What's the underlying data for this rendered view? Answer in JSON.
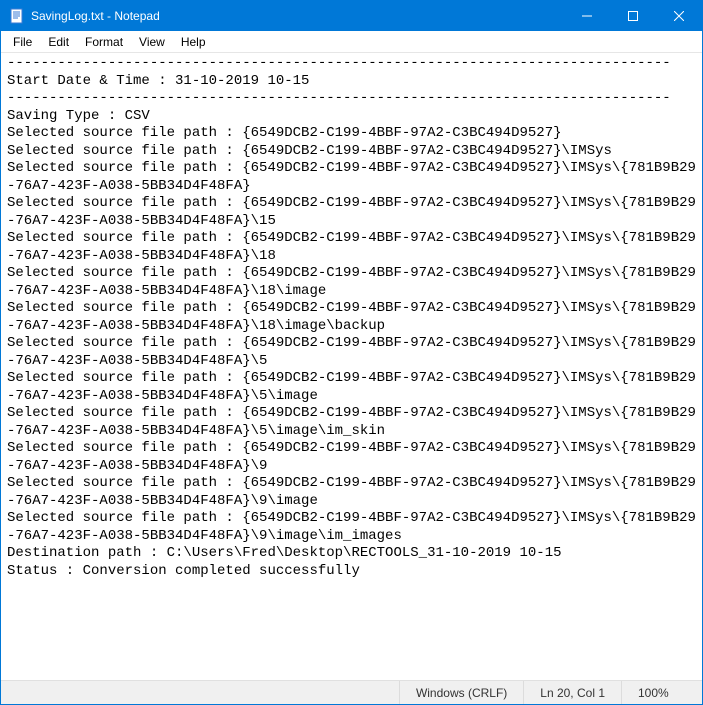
{
  "window": {
    "title": "SavingLog.txt - Notepad"
  },
  "menu": {
    "file": "File",
    "edit": "Edit",
    "format": "Format",
    "view": "View",
    "help": "Help"
  },
  "document": {
    "lines": [
      "-------------------------------------------------------------------------------",
      "Start Date & Time : 31-10-2019 10-15",
      "-------------------------------------------------------------------------------",
      "Saving Type : CSV",
      "Selected source file path : {6549DCB2-C199-4BBF-97A2-C3BC494D9527}",
      "Selected source file path : {6549DCB2-C199-4BBF-97A2-C3BC494D9527}\\IMSys",
      "Selected source file path : {6549DCB2-C199-4BBF-97A2-C3BC494D9527}\\IMSys\\{781B9B29-76A7-423F-A038-5BB34D4F48FA}",
      "Selected source file path : {6549DCB2-C199-4BBF-97A2-C3BC494D9527}\\IMSys\\{781B9B29-76A7-423F-A038-5BB34D4F48FA}\\15",
      "Selected source file path : {6549DCB2-C199-4BBF-97A2-C3BC494D9527}\\IMSys\\{781B9B29-76A7-423F-A038-5BB34D4F48FA}\\18",
      "Selected source file path : {6549DCB2-C199-4BBF-97A2-C3BC494D9527}\\IMSys\\{781B9B29-76A7-423F-A038-5BB34D4F48FA}\\18\\image",
      "Selected source file path : {6549DCB2-C199-4BBF-97A2-C3BC494D9527}\\IMSys\\{781B9B29-76A7-423F-A038-5BB34D4F48FA}\\18\\image\\backup",
      "Selected source file path : {6549DCB2-C199-4BBF-97A2-C3BC494D9527}\\IMSys\\{781B9B29-76A7-423F-A038-5BB34D4F48FA}\\5",
      "Selected source file path : {6549DCB2-C199-4BBF-97A2-C3BC494D9527}\\IMSys\\{781B9B29-76A7-423F-A038-5BB34D4F48FA}\\5\\image",
      "Selected source file path : {6549DCB2-C199-4BBF-97A2-C3BC494D9527}\\IMSys\\{781B9B29-76A7-423F-A038-5BB34D4F48FA}\\5\\image\\im_skin",
      "Selected source file path : {6549DCB2-C199-4BBF-97A2-C3BC494D9527}\\IMSys\\{781B9B29-76A7-423F-A038-5BB34D4F48FA}\\9",
      "Selected source file path : {6549DCB2-C199-4BBF-97A2-C3BC494D9527}\\IMSys\\{781B9B29-76A7-423F-A038-5BB34D4F48FA}\\9\\image",
      "Selected source file path : {6549DCB2-C199-4BBF-97A2-C3BC494D9527}\\IMSys\\{781B9B29-76A7-423F-A038-5BB34D4F48FA}\\9\\image\\im_images",
      "Destination path : C:\\Users\\Fred\\Desktop\\RECTOOLS_31-10-2019 10-15",
      "Status : Conversion completed successfully"
    ]
  },
  "statusbar": {
    "encoding": "Windows (CRLF)",
    "cursor": "Ln 20, Col 1",
    "zoom": "100%"
  }
}
